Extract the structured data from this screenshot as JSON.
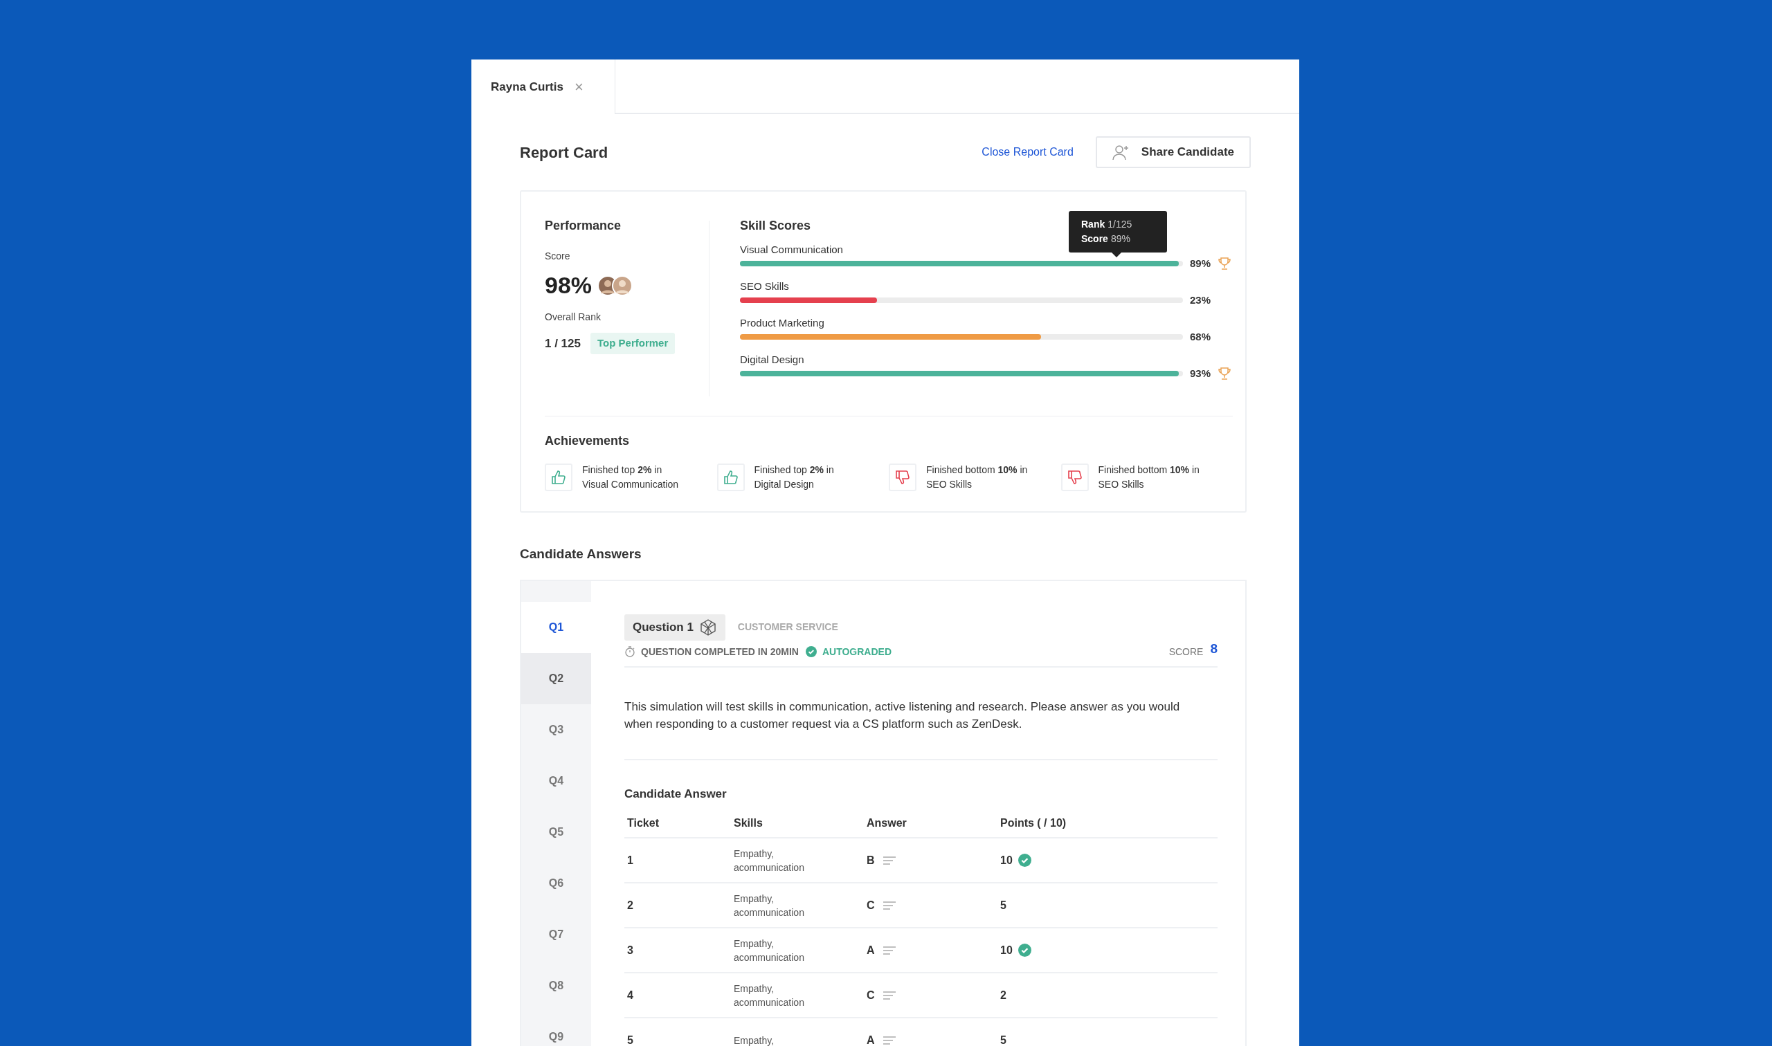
{
  "tab": {
    "label": "Rayna Curtis",
    "close": "×"
  },
  "header": {
    "title": "Report Card",
    "link": "Close Report Card",
    "button": "Share Candidate"
  },
  "performance": {
    "title": "Performance",
    "score_label": "Score",
    "score": "98%",
    "rank_label": "Overall Rank",
    "rank": "1 / 125",
    "badge": "Top Performer"
  },
  "skills": {
    "title": "Skill Scores",
    "tooltip": {
      "rank_label": "Rank",
      "rank": "1/125",
      "score_label": "Score",
      "score": "89%"
    },
    "items": [
      {
        "name": "Visual Communication",
        "level": 0.99,
        "reading": "89%",
        "color": "#4cb39a",
        "trophy": true
      },
      {
        "name": "SEO Skills",
        "level": 0.31,
        "reading": "23%",
        "color": "#e5404e",
        "trophy": false
      },
      {
        "name": "Product Marketing",
        "level": 0.68,
        "reading": "68%",
        "color": "#ef9b45",
        "trophy": false
      },
      {
        "name": "Digital Design",
        "level": 0.99,
        "reading": "93%",
        "color": "#4cb39a",
        "trophy": true
      }
    ]
  },
  "achievements": {
    "title": "Achievements",
    "items": [
      {
        "kind": "up",
        "text": "Finished top **2%** in Visual Communication"
      },
      {
        "kind": "up",
        "text": "Finished top **2%** in Digital Design"
      },
      {
        "kind": "down",
        "text": "Finished bottom **10%** in SEO Skills"
      },
      {
        "kind": "down",
        "text": "Finished bottom **10%** in SEO Skills"
      }
    ]
  },
  "answers": {
    "title": "Candidate Answers",
    "questions": [
      {
        "label": "Q1",
        "selected": true,
        "hovered": false
      },
      {
        "label": "Q2",
        "selected": false,
        "hovered": true
      },
      {
        "label": "Q3",
        "selected": false,
        "hovered": false
      },
      {
        "label": "Q4",
        "selected": false,
        "hovered": false
      },
      {
        "label": "Q5",
        "selected": false,
        "hovered": false
      },
      {
        "label": "Q6",
        "selected": false,
        "hovered": false
      },
      {
        "label": "Q7",
        "selected": false,
        "hovered": false
      },
      {
        "label": "Q8",
        "selected": false,
        "hovered": false
      },
      {
        "label": "Q9",
        "selected": false,
        "hovered": false
      }
    ],
    "question": {
      "chip": "Question 1",
      "category": "CUSTOMER SERVICE",
      "completed": "QUESTION COMPLETED IN 20MIN",
      "status": "AUTOGRADED",
      "score_label": "SCORE",
      "score": "8",
      "description": "This simulation will test skills in communication, active listening and research. Please answer as you would when responding to a customer request via a CS platform such as ZenDesk.",
      "answer_title": "Candidate Answer",
      "columns": [
        "Ticket",
        "Skills",
        "Answer",
        "Points ( / 10)"
      ],
      "rows": [
        {
          "ticket": "1",
          "skills": "Empathy, acommunication",
          "answer": "B",
          "points": "10",
          "correct": true
        },
        {
          "ticket": "2",
          "skills": "Empathy, acommunication",
          "answer": "C",
          "points": "5",
          "correct": false
        },
        {
          "ticket": "3",
          "skills": "Empathy, acommunication",
          "answer": "A",
          "points": "10",
          "correct": true
        },
        {
          "ticket": "4",
          "skills": "Empathy, acommunication",
          "answer": "C",
          "points": "2",
          "correct": false
        },
        {
          "ticket": "5",
          "skills": "Empathy,",
          "answer": "A",
          "points": "5",
          "correct": false
        }
      ]
    }
  }
}
